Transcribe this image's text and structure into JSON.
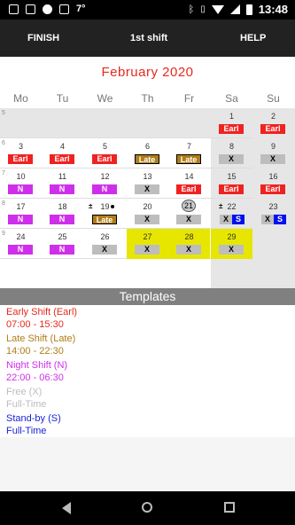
{
  "status_bar": {
    "temperature": "7°",
    "time": "13:48"
  },
  "toolbar": {
    "finish": "FINISH",
    "shift_select": "1st shift",
    "help": "HELP"
  },
  "calendar": {
    "month_title": "February  2020",
    "weekdays": [
      "Mo",
      "Tu",
      "We",
      "Th",
      "Fr",
      "Sa",
      "Su"
    ],
    "weeks": [
      {
        "number": "5",
        "days": [
          {
            "day": ""
          },
          {
            "day": ""
          },
          {
            "day": ""
          },
          {
            "day": ""
          },
          {
            "day": ""
          },
          {
            "day": "1",
            "shift": "Earl",
            "kind": "earl"
          },
          {
            "day": "2",
            "shift": "Earl",
            "kind": "earl"
          }
        ]
      },
      {
        "number": "6",
        "days": [
          {
            "day": "3",
            "shift": "Earl",
            "kind": "earl"
          },
          {
            "day": "4",
            "shift": "Earl",
            "kind": "earl"
          },
          {
            "day": "5",
            "shift": "Earl",
            "kind": "earl"
          },
          {
            "day": "6",
            "shift": "Late",
            "kind": "late"
          },
          {
            "day": "7",
            "shift": "Late",
            "kind": "late"
          },
          {
            "day": "8",
            "shift": "X",
            "kind": "x"
          },
          {
            "day": "9",
            "shift": "X",
            "kind": "x"
          }
        ]
      },
      {
        "number": "7",
        "days": [
          {
            "day": "10",
            "shift": "N",
            "kind": "n"
          },
          {
            "day": "11",
            "shift": "N",
            "kind": "n"
          },
          {
            "day": "12",
            "shift": "N",
            "kind": "n"
          },
          {
            "day": "13",
            "shift": "X",
            "kind": "x"
          },
          {
            "day": "14",
            "shift": "Earl",
            "kind": "earl"
          },
          {
            "day": "15",
            "shift": "Earl",
            "kind": "earl"
          },
          {
            "day": "16",
            "shift": "Earl",
            "kind": "earl"
          }
        ]
      },
      {
        "number": "8",
        "days": [
          {
            "day": "17",
            "shift": "N",
            "kind": "n"
          },
          {
            "day": "18",
            "shift": "N",
            "kind": "n"
          },
          {
            "day": "19",
            "shift": "Late",
            "kind": "late",
            "prefix": "±",
            "dot": true
          },
          {
            "day": "20",
            "shift": "X",
            "kind": "x"
          },
          {
            "day": "21",
            "shift": "X",
            "kind": "x",
            "today": true
          },
          {
            "day": "22",
            "shift": "X",
            "kind": "xs",
            "second": "S",
            "prefix": "±"
          },
          {
            "day": "23",
            "shift": "X",
            "kind": "xs",
            "second": "S"
          }
        ]
      },
      {
        "number": "9",
        "days": [
          {
            "day": "24",
            "shift": "N",
            "kind": "n"
          },
          {
            "day": "25",
            "shift": "N",
            "kind": "n"
          },
          {
            "day": "26",
            "shift": "X",
            "kind": "x"
          },
          {
            "day": "27",
            "shift": "X",
            "kind": "x",
            "highlight": true
          },
          {
            "day": "28",
            "shift": "X",
            "kind": "x",
            "highlight": true
          },
          {
            "day": "29",
            "shift": "X",
            "kind": "x",
            "highlight": true
          },
          {
            "day": ""
          }
        ]
      }
    ]
  },
  "templates": {
    "header": "Templates",
    "items": [
      {
        "name": "Early Shift (Earl)",
        "time": "07:00 - 15:30",
        "color": "#e8281c"
      },
      {
        "name": "Late Shift (Late)",
        "time": "14:00 - 22:30",
        "color": "#b07d16"
      },
      {
        "name": "Night Shift (N)",
        "time": "22:00 - 06:30",
        "color": "#cf2fea"
      },
      {
        "name": "Free (X)",
        "time": "Full-Time",
        "color": "#bdbdbd"
      },
      {
        "name": "Stand-by (S)",
        "time": "Full-Time",
        "color": "#1a23d6"
      }
    ]
  }
}
